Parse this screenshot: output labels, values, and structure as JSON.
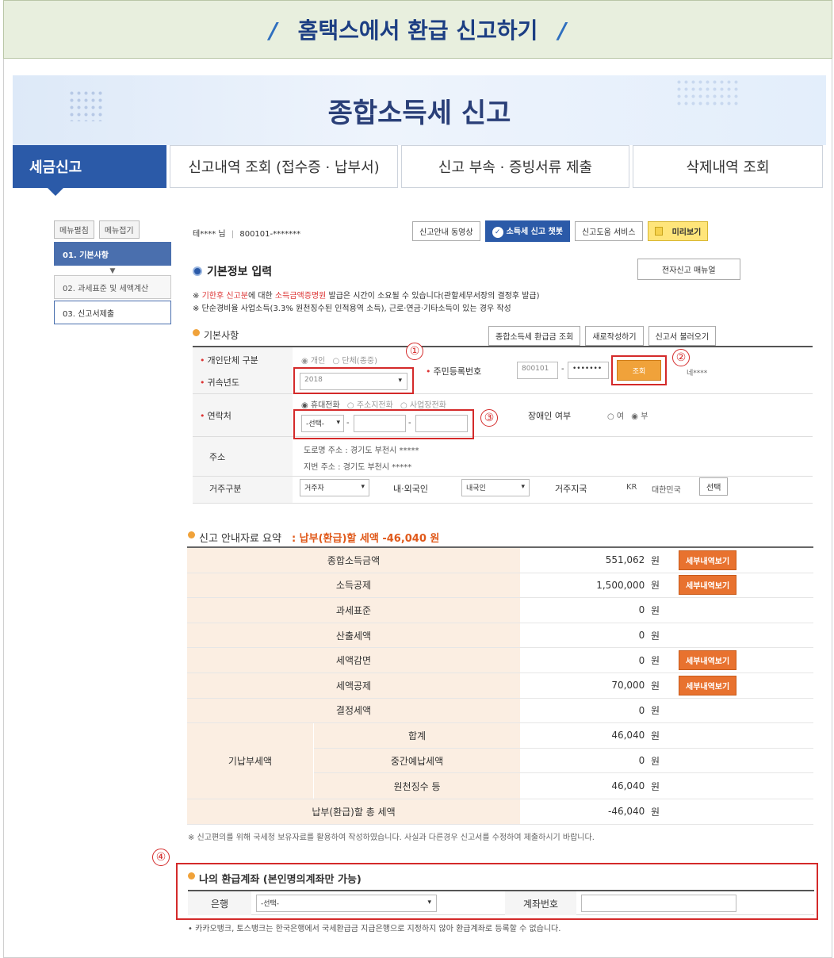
{
  "banner": {
    "title": "홈택스에서 환급 신고하기",
    "slash": "/"
  },
  "hero": {
    "title": "종합소득세 신고"
  },
  "tabs": [
    {
      "label": "세금신고"
    },
    {
      "label": "신고내역 조회 (접수증 · 납부서)"
    },
    {
      "label": "신고 부속 · 증빙서류 제출"
    },
    {
      "label": "삭제내역 조회"
    }
  ],
  "side": {
    "btn_expand": "메뉴펼침",
    "btn_collapse": "메뉴접기",
    "steps": [
      "01. 기본사항",
      "02. 과세표준 및 세액계산",
      "03. 신고서제출"
    ]
  },
  "user": {
    "name": "테**** 님",
    "id": "800101-*******"
  },
  "top_buttons": {
    "video": "신고안내 동영상",
    "chatbot": "소득세 신고 챗봇",
    "help": "신고도움 서비스",
    "preview": "미리보기"
  },
  "basic": {
    "title": "기본정보 입력",
    "manual_button": "전자신고 매뉴얼",
    "note1_prefix": "※ ",
    "note1_red": "기한후 신고분",
    "note1_mid": "에 대한 ",
    "note1_red2": "소득금액증명원",
    "note1_rest": " 발급은 시간이 소요될 수 있습니다(관할세무서장의 결정후 발급)",
    "note2": "※ 단순경비율 사업소득(3.3% 원천징수된 인적용역 소득), 근로·연금·기타소득이 있는 경우 작성"
  },
  "basics_section": {
    "title": "기본사항",
    "btn_refund": "종합소득세 환급금 조회",
    "btn_new": "새로작성하기",
    "btn_load": "신고서 불러오기"
  },
  "form": {
    "type_label": "개인단체 구분",
    "type_opt1": "개인",
    "type_opt2": "단체(종중)",
    "year_label": "귀속년도",
    "year_value": "2018",
    "rrn_label": "주민등록번호",
    "rrn_front": "800101",
    "rrn_back": "•••••••",
    "lookup_btn": "조회",
    "name_after": "네****",
    "contact_label": "연락처",
    "contact_opt1": "휴대전화",
    "contact_opt2": "주소지전화",
    "contact_opt3": "사업장전화",
    "phone_select": "-선택-",
    "disabled_label": "장애인 여부",
    "yes": "여",
    "no": "부",
    "addr_label": "주소",
    "addr_road": "도로명 주소 : 경기도 부천시 *****",
    "addr_lot": "지번 주소 : 경기도 부천시 *****",
    "residence_label": "거주구분",
    "residence_value": "거주자",
    "nationality_label": "내·외국인",
    "nationality_value": "내국인",
    "country_label": "거주지국",
    "country_code": "KR",
    "country_name": "대한민국",
    "country_btn": "선택"
  },
  "summary": {
    "title": "신고 안내자료 요약",
    "tax_label": ": 납부(환급)할 세액 -46,040 원",
    "unit": "원",
    "detail_btn": "세부내역보기",
    "rows": [
      {
        "label": "종합소득금액",
        "value": "551,062",
        "btn": true
      },
      {
        "label": "소득공제",
        "value": "1,500,000",
        "btn": true
      },
      {
        "label": "과세표준",
        "value": "0",
        "btn": false
      },
      {
        "label": "산출세액",
        "value": "0",
        "btn": false
      },
      {
        "label": "세액감면",
        "value": "0",
        "btn": true
      },
      {
        "label": "세액공제",
        "value": "70,000",
        "btn": true
      },
      {
        "label": "결정세액",
        "value": "0",
        "btn": false
      }
    ],
    "prepaid_head": "기납부세액",
    "prepaid_rows": [
      {
        "label": "합계",
        "value": "46,040"
      },
      {
        "label": "중간예납세액",
        "value": "0"
      },
      {
        "label": "원천징수 등",
        "value": "46,040"
      }
    ],
    "total_label": "납부(환급)할 총 세액",
    "total_value": "-46,040",
    "footnote": "※ 신고편의를 위해 국세청 보유자료를 활용하여 작성하였습니다. 사실과 다른경우 신고서를 수정하여 제출하시기 바랍니다."
  },
  "refund": {
    "title": "나의 환급계좌 (본인명의계좌만 가능)",
    "bank_label": "은행",
    "bank_select": "-선택-",
    "account_label": "계좌번호",
    "note": "• 카카오뱅크, 토스뱅크는 한국은행에서 국세환급금 지급은행으로 지정하지 않아 환급계좌로 등록할 수 없습니다."
  },
  "markers": [
    "①",
    "②",
    "③",
    "④"
  ],
  "colors": {
    "accent": "#2b5aa8",
    "highlight": "#d42a2a",
    "orange": "#e8722f"
  }
}
